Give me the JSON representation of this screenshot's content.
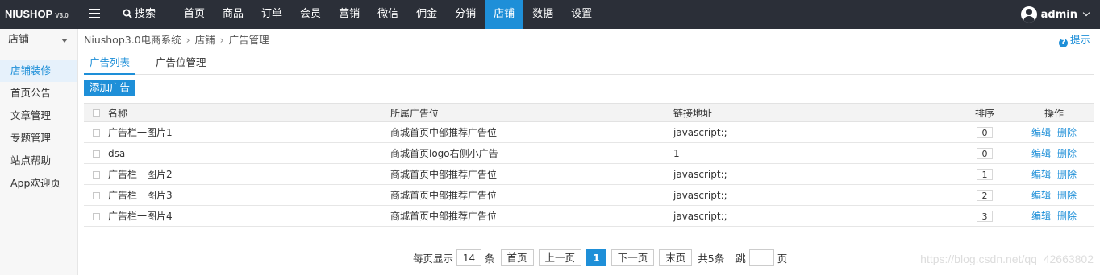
{
  "brand": {
    "name_part1": "NIUSHOP",
    "version": "V3.0"
  },
  "topbar": {
    "search_label": "搜索",
    "nav": [
      "首页",
      "商品",
      "订单",
      "会员",
      "营销",
      "微信",
      "佣金",
      "分销",
      "店铺",
      "数据",
      "设置"
    ],
    "active_nav": "店铺",
    "user_name": "admin",
    "accent_color": "#1e8fd8",
    "bg_color": "#2b2f38"
  },
  "sidebar": {
    "header": "店铺",
    "items": [
      {
        "label": "店铺装修",
        "active": true
      },
      {
        "label": "首页公告",
        "active": false
      },
      {
        "label": "文章管理",
        "active": false
      },
      {
        "label": "专题管理",
        "active": false
      },
      {
        "label": "站点帮助",
        "active": false
      },
      {
        "label": "App欢迎页",
        "active": false
      }
    ]
  },
  "breadcrumb": [
    "Niushop3.0电商系统",
    "店铺",
    "广告管理"
  ],
  "tip_label": "提示",
  "tabs": [
    {
      "label": "广告列表",
      "active": true
    },
    {
      "label": "广告位管理",
      "active": false
    }
  ],
  "add_button_label": "添加广告",
  "table": {
    "headers": {
      "name": "名称",
      "position": "所属广告位",
      "link": "链接地址",
      "sort": "排序",
      "op": "操作"
    },
    "rows": [
      {
        "name": "广告栏一图片1",
        "position": "商城首页中部推荐广告位",
        "link": "javascript:;",
        "sort": "0"
      },
      {
        "name": "dsa",
        "position": "商城首页logo右侧小广告",
        "link": "1",
        "sort": "0"
      },
      {
        "name": "广告栏一图片2",
        "position": "商城首页中部推荐广告位",
        "link": "javascript:;",
        "sort": "1"
      },
      {
        "name": "广告栏一图片3",
        "position": "商城首页中部推荐广告位",
        "link": "javascript:;",
        "sort": "2"
      },
      {
        "name": "广告栏一图片4",
        "position": "商城首页中部推荐广告位",
        "link": "javascript:;",
        "sort": "3"
      }
    ],
    "edit_label": "编辑",
    "delete_label": "删除"
  },
  "pager": {
    "per_page_prefix": "每页显示",
    "per_page_value": "14",
    "per_page_suffix": "条",
    "first": "首页",
    "prev": "上一页",
    "current": "1",
    "next": "下一页",
    "last": "末页",
    "total": "共5条",
    "jump_label": "跳",
    "page_suffix": "页"
  },
  "watermark": "https://blog.csdn.net/qq_42663802"
}
